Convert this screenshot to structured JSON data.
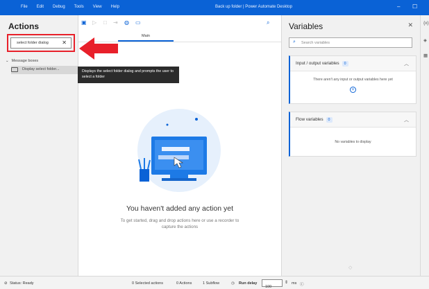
{
  "menu": [
    "File",
    "Edit",
    "Debug",
    "Tools",
    "View",
    "Help"
  ],
  "window_title": "Back up folder | Power Automate Desktop",
  "actions": {
    "title": "Actions",
    "search_value": "select folder dialog",
    "group_label": "Message boxes",
    "item_label": "Display select folder..."
  },
  "tooltip": "Displays the select folder dialog and prompts the user to select a folder",
  "main": {
    "tab_label": "Main",
    "empty_title": "You haven't added any action yet",
    "empty_sub": "To get started, drag and drop actions here or use a recorder to capture the actions"
  },
  "variables": {
    "title": "Variables",
    "search_placeholder": "Search variables",
    "io_title": "Input / output variables",
    "io_count": "0",
    "io_empty": "There aren't any input or output variables here yet",
    "flow_title": "Flow variables",
    "flow_count": "0",
    "flow_empty": "No variables to display"
  },
  "status": {
    "ready": "Status: Ready",
    "selected": "0 Selected actions",
    "actions": "0 Actions",
    "subflow": "1 Subflow",
    "run_delay_label": "Run delay",
    "run_delay_value": "100",
    "unit": "ms"
  },
  "colors": {
    "accent": "#0a62d6",
    "highlight": "#e8202a"
  }
}
